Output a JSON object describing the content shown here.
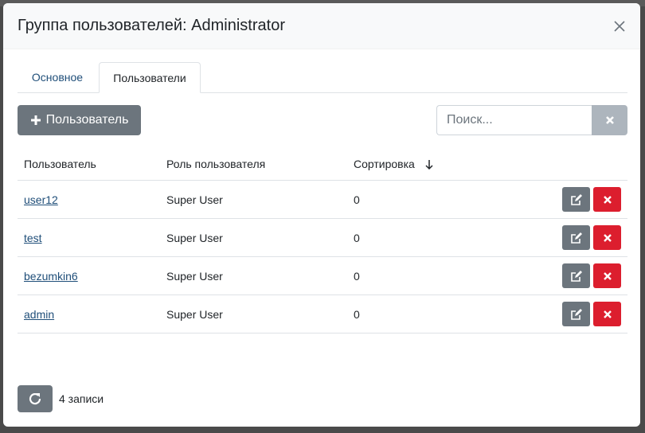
{
  "modal": {
    "title": "Группа пользователей: Administrator"
  },
  "tabs": [
    {
      "label": "Основное",
      "active": false
    },
    {
      "label": "Пользователи",
      "active": true
    }
  ],
  "toolbar": {
    "add_label": "Пользователь",
    "add_icon": "plus-icon",
    "search_placeholder": "Поиск...",
    "search_value": ""
  },
  "table": {
    "columns": [
      "Пользователь",
      "Роль пользователя",
      "Сортировка"
    ],
    "sort_icon": "arrow-down-icon",
    "rows": [
      {
        "user": "user12",
        "role": "Super User",
        "sort": "0"
      },
      {
        "user": "test",
        "role": "Super User",
        "sort": "0"
      },
      {
        "user": "bezumkin6",
        "role": "Super User",
        "sort": "0"
      },
      {
        "user": "admin",
        "role": "Super User",
        "sort": "0"
      }
    ]
  },
  "footer": {
    "count_text": "4 записи",
    "refresh_icon": "refresh-icon"
  },
  "colors": {
    "secondary": "#6c757d",
    "danger": "#dc1e2e",
    "link": "#1f4e79"
  }
}
